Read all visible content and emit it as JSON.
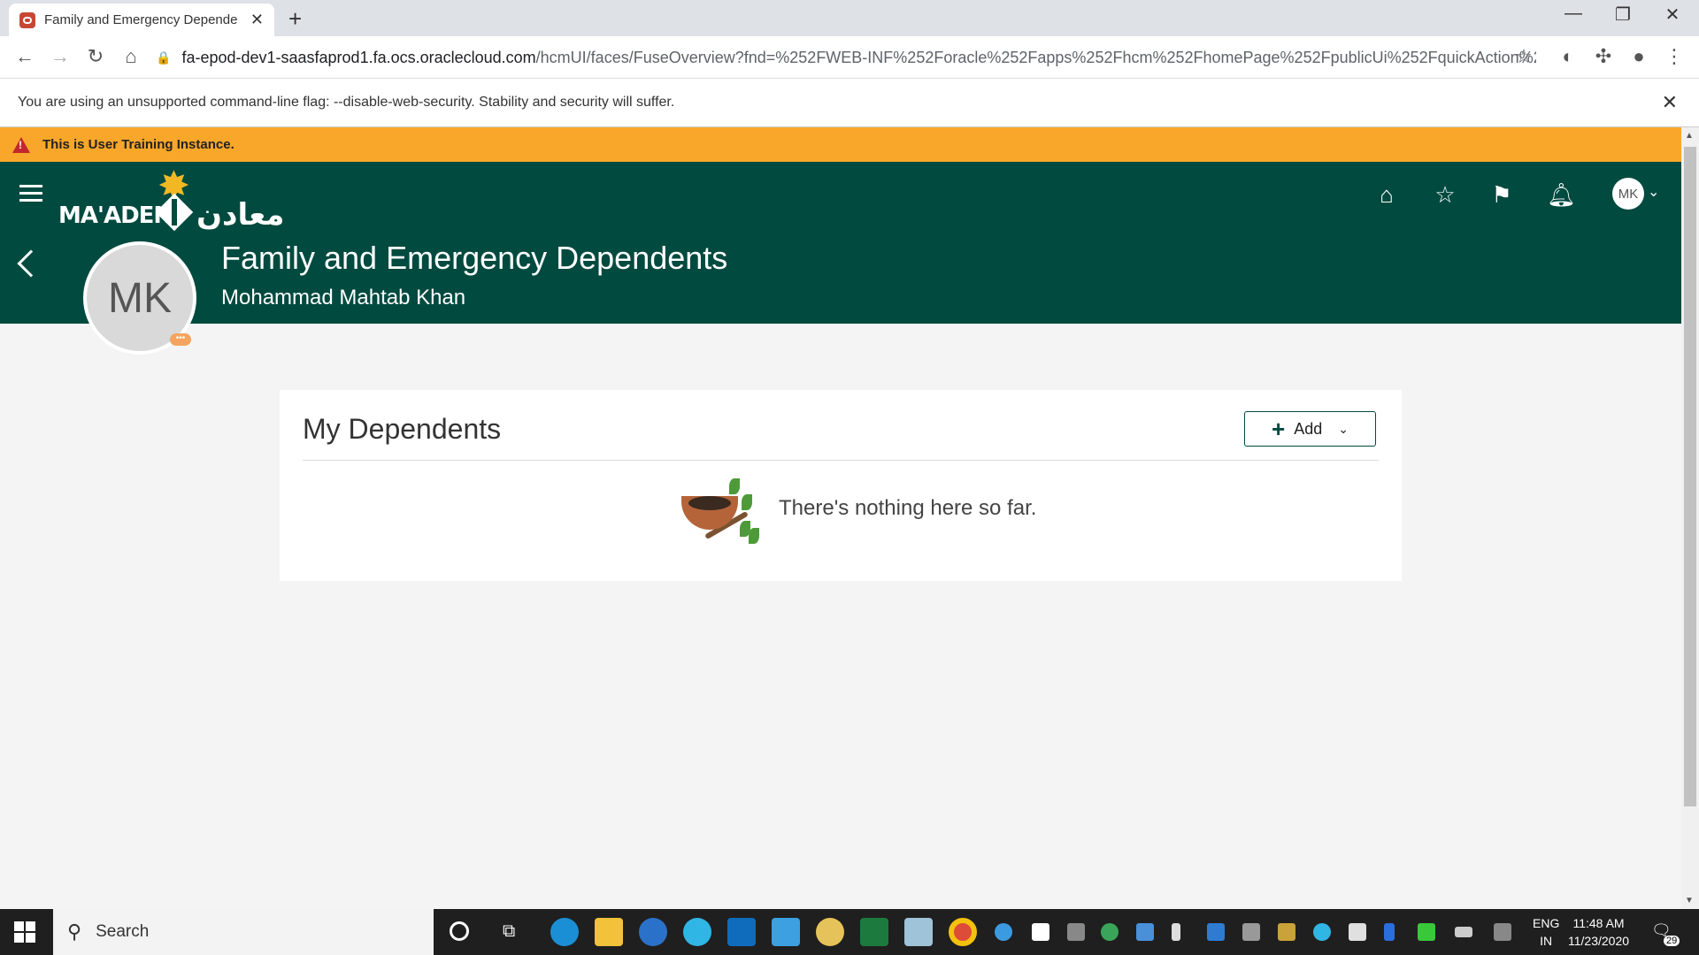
{
  "browser": {
    "tab_title": "Family and Emergency Depende",
    "url_host": "fa-epod-dev1-saasfaprod1.fa.ocs.oraclecloud.com",
    "url_path": "/hcmUI/faces/FuseOverview?fnd=%252FWEB-INF%252Foracle%252Fapps%252Fhcm%252FhomePage%252FpublicUi%252FquickAction%25...",
    "infobar_text": "You are using an unsupported command-line flag: --disable-web-security. Stability and security will suffer."
  },
  "banner": {
    "text": "This is User Training Instance."
  },
  "header": {
    "logo_latin": "MA'ADEN",
    "logo_arabic": "معادن",
    "user_initials": "MK",
    "page_title": "Family and Emergency Dependents",
    "person_name": "Mohammad Mahtab Khan",
    "photo_initials": "MK"
  },
  "card": {
    "title": "My Dependents",
    "add_label": "Add",
    "empty_text": "There's nothing here so far."
  },
  "taskbar": {
    "search_text": "Search",
    "lang_line1": "ENG",
    "lang_line2": "IN",
    "time": "11:48 AM",
    "date": "11/23/2020",
    "notification_count": "29"
  },
  "colors": {
    "header_green": "#004a3f",
    "banner_orange": "#f9a72a",
    "logo_gold": "#f2b824"
  }
}
